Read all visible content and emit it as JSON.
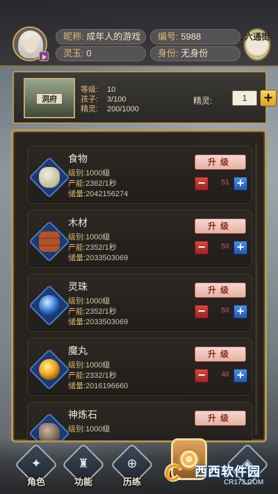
{
  "player": {
    "nickname_label": "昵称:",
    "nickname": "成年人的游戏",
    "id_label": "编号:",
    "id": "5988",
    "jade_label": "灵玉:",
    "jade": "0",
    "status_label": "身份:",
    "status": "无身份",
    "street_badge": "六通街"
  },
  "cave": {
    "name": "洞府",
    "level_label": "等级:",
    "level": "10",
    "children_label": "孩子:",
    "children": "3/100",
    "spirit_label": "精灵:",
    "spirit": "200/1000",
    "spirit_side_label": "精灵:",
    "spirit_input": "1",
    "spirit_plus": "+"
  },
  "resources": [
    {
      "name": "食物",
      "icon": "food-sack-icon",
      "level_label": "级别:",
      "level": "1000级",
      "prod_label": "产能:",
      "prod": "2362/1秒",
      "store_label": "储量:",
      "store": "2042156274",
      "upgrade": "升级",
      "count": "51"
    },
    {
      "name": "木材",
      "icon": "wood-logs-icon",
      "level_label": "级别:",
      "level": "1000级",
      "prod_label": "产能:",
      "prod": "2352/1秒",
      "store_label": "储量:",
      "store": "2033503069",
      "upgrade": "升级",
      "count": "50"
    },
    {
      "name": "灵珠",
      "icon": "spirit-pearl-icon",
      "level_label": "级别:",
      "level": "1000级",
      "prod_label": "产能:",
      "prod": "2352/1秒",
      "store_label": "储量:",
      "store": "2033503069",
      "upgrade": "升级",
      "count": "50"
    },
    {
      "name": "魔丸",
      "icon": "magic-pill-icon",
      "level_label": "级别:",
      "level": "1000级",
      "prod_label": "产能:",
      "prod": "2332/1秒",
      "store_label": "储量:",
      "store": "2016196660",
      "upgrade": "升级",
      "count": "48"
    },
    {
      "name": "神炼石",
      "icon": "refining-stone-icon",
      "level_label": "级别:",
      "level": "1000级",
      "prod_label": "",
      "prod": "",
      "store_label": "",
      "store": "",
      "upgrade": "升级",
      "count": ""
    }
  ],
  "controls": {
    "minus": "−",
    "plus": "+"
  },
  "nav": {
    "role": "角色",
    "function": "功能",
    "history": "历练",
    "center": "",
    "last": ""
  },
  "watermark": {
    "text": "西西软件园",
    "url": "CR173.COM"
  }
}
